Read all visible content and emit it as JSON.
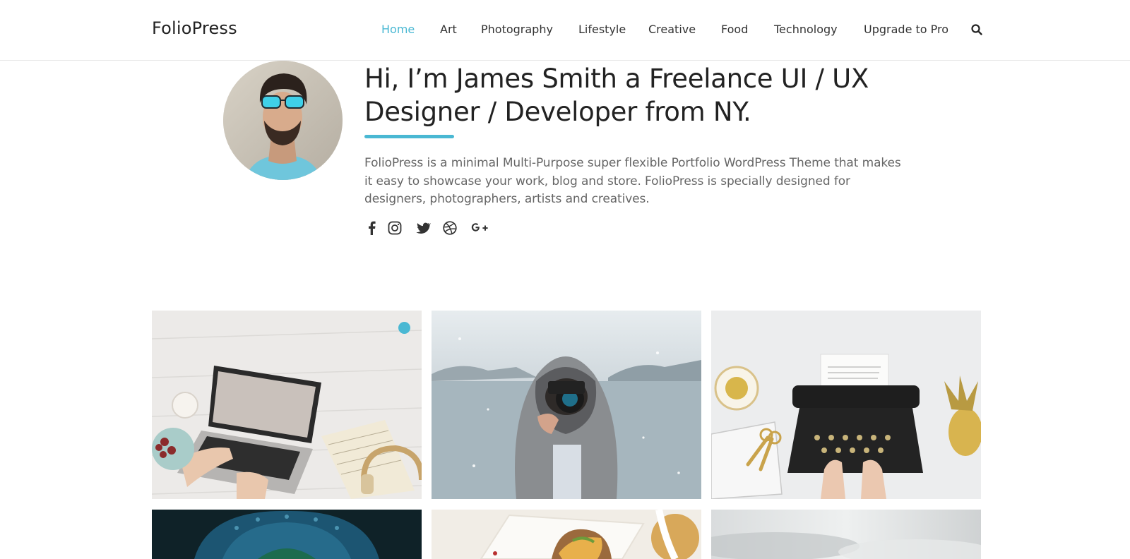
{
  "site": {
    "logo": "FolioPress",
    "accent_color": "#4ab8d3"
  },
  "nav": {
    "items": [
      {
        "label": "Home",
        "active": true
      },
      {
        "label": "Art"
      },
      {
        "label": "Photography"
      },
      {
        "label": "Lifestyle"
      },
      {
        "label": "Creative"
      },
      {
        "label": "Food"
      },
      {
        "label": "Technology"
      },
      {
        "label": "Upgrade to Pro"
      }
    ],
    "search_icon": "search-icon"
  },
  "hero": {
    "headline": "Hi, I’m James Smith a Freelance UI / UX Designer / Developer from NY.",
    "intro": "FolioPress is a minimal Multi-Purpose super flexible Portfolio WordPress Theme that makes it easy to showcase your work, blog and store. FolioPress is specially designed for designers, photographers, artists and creatives.",
    "avatar_icon": "profile-photo",
    "social": [
      "facebook-icon",
      "instagram-icon",
      "twitter-icon",
      "dribbble-icon",
      "google-plus-icon"
    ]
  },
  "gallery": {
    "items": [
      {
        "subject": "laptop-on-desk-photo"
      },
      {
        "subject": "photographer-in-snow-photo"
      },
      {
        "subject": "typewriter-photo"
      },
      {
        "subject": "ornament-blue-photo"
      },
      {
        "subject": "food-plate-photo"
      },
      {
        "subject": "blurred-interior-photo"
      }
    ]
  }
}
